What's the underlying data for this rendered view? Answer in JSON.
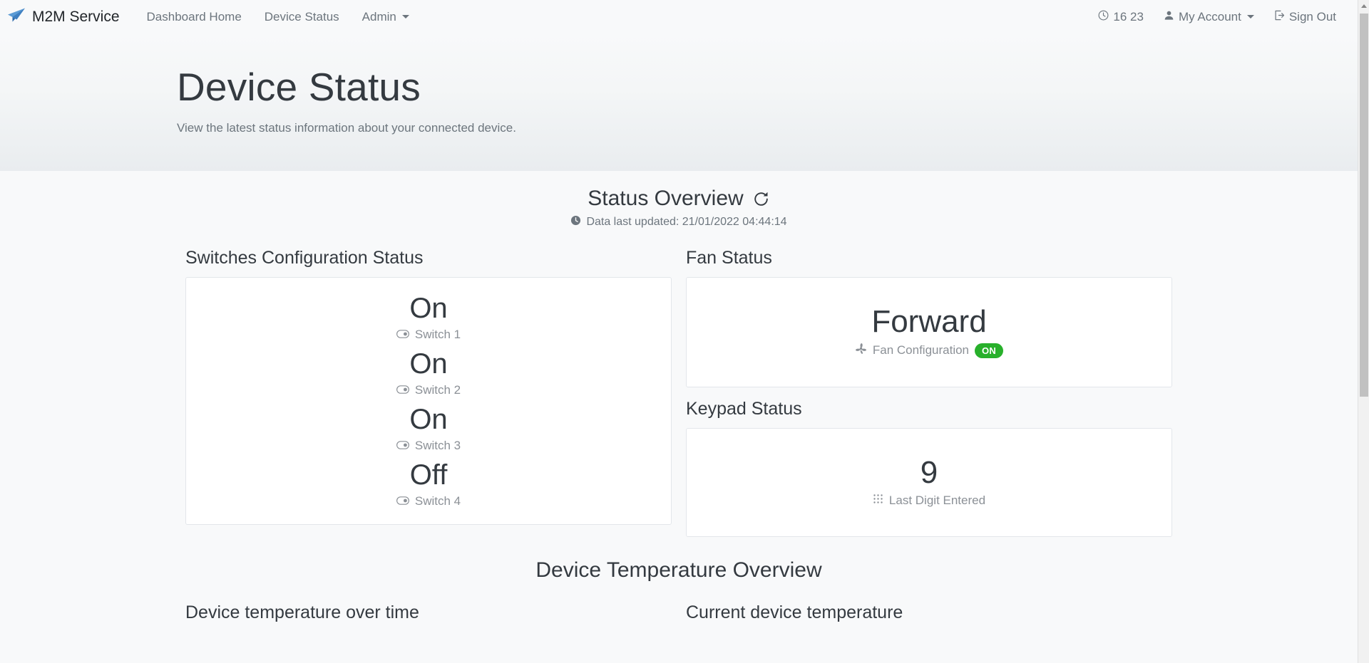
{
  "navbar": {
    "brand": "M2M Service",
    "brand_logo_icon": "paper-plane-icon",
    "links": [
      {
        "label": "Dashboard Home"
      },
      {
        "label": "Device Status"
      },
      {
        "label": "Admin",
        "has_caret": true
      }
    ],
    "right": {
      "clock_icon": "clock-icon",
      "time": "16 23",
      "account_icon": "person-icon",
      "account_label": "My Account",
      "signout_icon": "sign-out-icon",
      "signout_label": "Sign Out"
    }
  },
  "jumbotron": {
    "title": "Device Status",
    "subtitle": "View the latest status information about your connected device."
  },
  "overview": {
    "title": "Status Overview",
    "refresh_icon": "refresh-icon",
    "updated_icon": "clock-filled-icon",
    "updated_text": "Data last updated: 21/01/2022 04:44:14"
  },
  "switches": {
    "heading": "Switches Configuration Status",
    "items": [
      {
        "value": "On",
        "label": "Switch 1",
        "icon": "toggle-on-icon"
      },
      {
        "value": "On",
        "label": "Switch 2",
        "icon": "toggle-on-icon"
      },
      {
        "value": "On",
        "label": "Switch 3",
        "icon": "toggle-on-icon"
      },
      {
        "value": "Off",
        "label": "Switch 4",
        "icon": "toggle-on-icon"
      }
    ]
  },
  "fan": {
    "heading": "Fan Status",
    "value": "Forward",
    "label": "Fan Configuration",
    "icon": "fan-icon",
    "badge": "ON",
    "badge_color": "#28b02b"
  },
  "keypad": {
    "heading": "Keypad Status",
    "value": "9",
    "label": "Last Digit Entered",
    "icon": "keypad-grid-icon"
  },
  "temperature": {
    "title": "Device Temperature Overview",
    "left_heading": "Device temperature over time",
    "right_heading": "Current device temperature"
  }
}
